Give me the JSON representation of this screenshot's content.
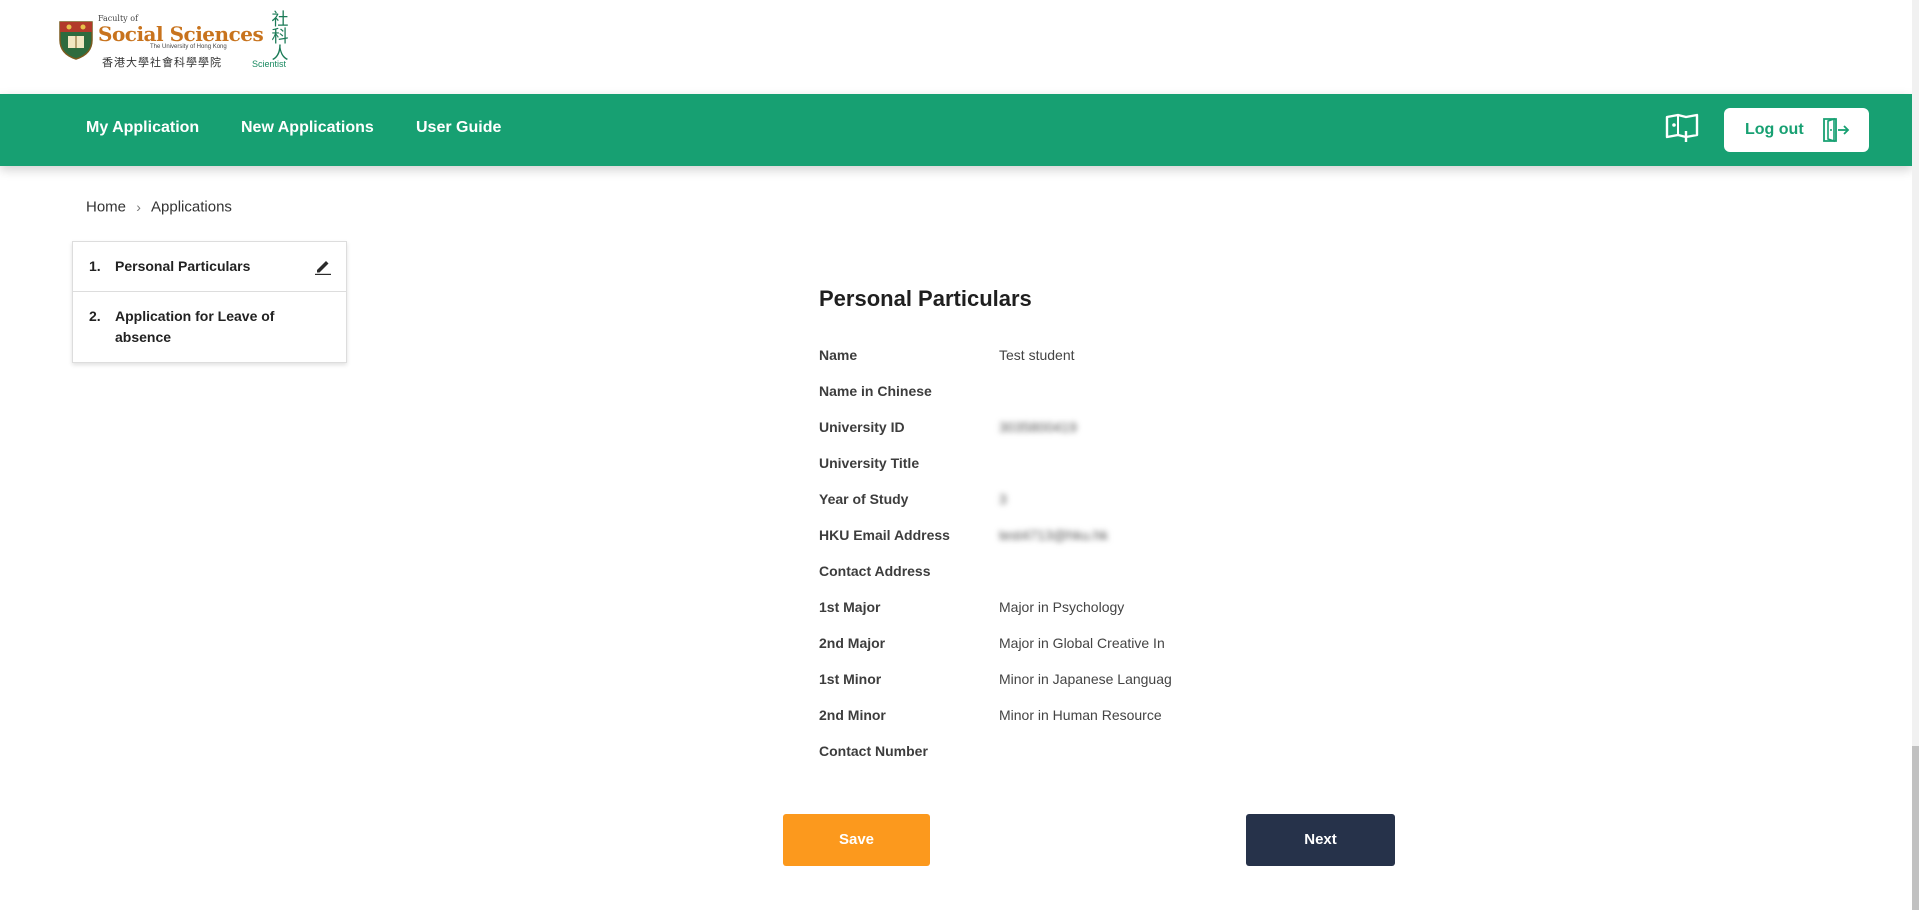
{
  "header": {
    "logo": {
      "faculty_small": "Faculty of",
      "faculty_main": "Social Sciences",
      "university": "The University of Hong Kong",
      "chinese": "香港大學社會科學學院",
      "scientist_cn": "社科人",
      "scientist_en": "Scientist"
    }
  },
  "nav": {
    "items": [
      {
        "label": "My Application"
      },
      {
        "label": "New Applications"
      },
      {
        "label": "User Guide"
      }
    ],
    "guide_icon": "book-map-icon",
    "logout_label": "Log out",
    "logout_icon": "door-exit-icon",
    "accent_color": "#17a072"
  },
  "breadcrumb": {
    "home": "Home",
    "current": "Applications"
  },
  "steps": [
    {
      "num": "1.",
      "label": "Personal Particulars",
      "icon": "pencil-edit-icon"
    },
    {
      "num": "2.",
      "label": "Application for Leave of absence"
    }
  ],
  "form": {
    "title": "Personal Particulars",
    "fields": [
      {
        "label": "Name",
        "value": "Test student"
      },
      {
        "label": "Name in Chinese",
        "value": ""
      },
      {
        "label": "University ID",
        "value": "3035800419"
      },
      {
        "label": "University Title",
        "value": ""
      },
      {
        "label": "Year of Study",
        "value": "3"
      },
      {
        "label": "HKU Email Address",
        "value": "test4713@hku.hk"
      },
      {
        "label": "Contact Address",
        "value": ""
      },
      {
        "label": "1st Major",
        "value": "Major in Psychology"
      },
      {
        "label": "2nd Major",
        "value": "Major in Global Creative In"
      },
      {
        "label": "1st Minor",
        "value": "Minor in Japanese Languag"
      },
      {
        "label": "2nd Minor",
        "value": "Minor in Human Resource"
      },
      {
        "label": "Contact Number",
        "value": ""
      }
    ],
    "save_label": "Save",
    "next_label": "Next",
    "save_color": "#fc991d",
    "next_color": "#26324a"
  }
}
